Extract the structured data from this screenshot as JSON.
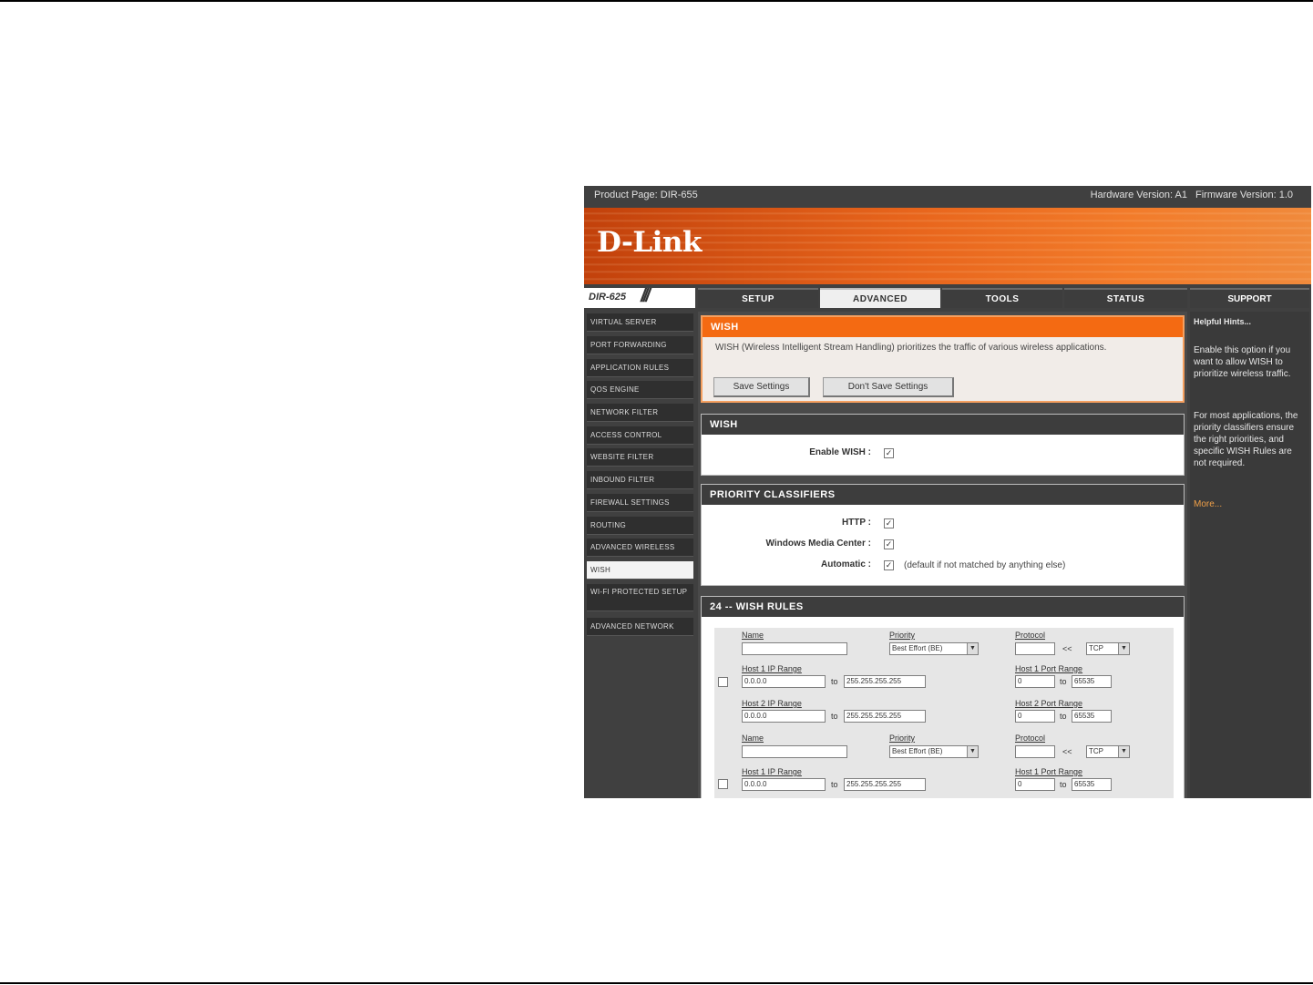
{
  "header": {
    "product_page": "Product Page: DIR-655",
    "hardware_version": "Hardware Version: A1",
    "firmware_version": "Firmware Version: 1.0"
  },
  "brand": {
    "logo_text": "D-Link"
  },
  "model": "DIR-625",
  "tabs": [
    {
      "label": "SETUP"
    },
    {
      "label": "ADVANCED"
    },
    {
      "label": "TOOLS"
    },
    {
      "label": "STATUS"
    },
    {
      "label": "SUPPORT"
    }
  ],
  "sidebar": {
    "items": [
      {
        "label": "VIRTUAL SERVER"
      },
      {
        "label": "PORT FORWARDING"
      },
      {
        "label": "APPLICATION RULES"
      },
      {
        "label": "QOS ENGINE"
      },
      {
        "label": "NETWORK FILTER"
      },
      {
        "label": "ACCESS CONTROL"
      },
      {
        "label": "WEBSITE FILTER"
      },
      {
        "label": "INBOUND FILTER"
      },
      {
        "label": "FIREWALL SETTINGS"
      },
      {
        "label": "ROUTING"
      },
      {
        "label": "ADVANCED WIRELESS"
      },
      {
        "label": "WISH"
      },
      {
        "label": "WI-FI PROTECTED SETUP"
      },
      {
        "label": "ADVANCED NETWORK"
      }
    ]
  },
  "intro_panel": {
    "title": "WISH",
    "description": "WISH (Wireless Intelligent Stream Handling) prioritizes the traffic of various wireless applications.",
    "save_label": "Save Settings",
    "dont_save_label": "Don't Save Settings"
  },
  "wish_panel": {
    "title": "WISH",
    "enable_label": "Enable WISH :",
    "enable_checked": true
  },
  "priority_panel": {
    "title": "PRIORITY CLASSIFIERS",
    "http_label": "HTTP :",
    "wmc_label": "Windows Media Center :",
    "automatic_label": "Automatic :",
    "automatic_note": "(default if not matched by anything else)"
  },
  "rules_panel": {
    "title": "24 -- WISH RULES",
    "labels": {
      "name": "Name",
      "priority": "Priority",
      "protocol": "Protocol",
      "host1_ip": "Host 1 IP Range",
      "host1_port": "Host 1 Port Range",
      "host2_ip": "Host 2 IP Range",
      "host2_port": "Host 2 Port Range",
      "to": "to",
      "arrows": "<<"
    },
    "rules": [
      {
        "name": "",
        "priority": "Best Effort (BE)",
        "protocol_value": "",
        "protocol_select": "TCP",
        "host1_ip_from": "0.0.0.0",
        "host1_ip_to": "255.255.255.255",
        "host1_port_from": "0",
        "host1_port_to": "65535",
        "host2_ip_from": "0.0.0.0",
        "host2_ip_to": "255.255.255.255",
        "host2_port_from": "0",
        "host2_port_to": "65535"
      },
      {
        "name": "",
        "priority": "Best Effort (BE)",
        "protocol_value": "",
        "protocol_select": "TCP",
        "host1_ip_from": "0.0.0.0",
        "host1_ip_to": "255.255.255.255",
        "host1_port_from": "0",
        "host1_port_to": "65535"
      }
    ]
  },
  "support": {
    "title": "Helpful Hints...",
    "hint1": "Enable this option if you want to allow WISH to prioritize wireless traffic.",
    "hint2": "For most applications, the priority classifiers ensure the right priorities, and specific WISH Rules are not required.",
    "more": "More..."
  }
}
